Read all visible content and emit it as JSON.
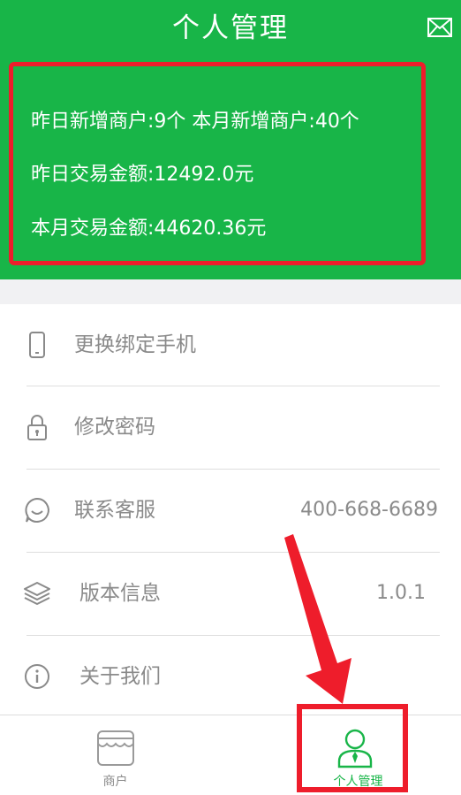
{
  "header": {
    "title": "个人管理"
  },
  "stats": {
    "line1": "昨日新增商户:9个   本月新增商户:40个",
    "line2": "昨日交易金额:12492.0元",
    "line3": "本月交易金额:44620.36元"
  },
  "menu": {
    "items": [
      {
        "label": "更换绑定手机",
        "value": "",
        "icon": "phone-icon"
      },
      {
        "label": "修改密码",
        "value": "",
        "icon": "lock-icon"
      },
      {
        "label": "联系客服",
        "value": "400-668-6689",
        "icon": "chat-icon"
      },
      {
        "label": "版本信息",
        "value": "1.0.1",
        "icon": "layers-icon"
      },
      {
        "label": "关于我们",
        "value": "",
        "icon": "info-icon"
      }
    ]
  },
  "tabbar": {
    "tabs": [
      {
        "label": "商户",
        "icon": "store-icon",
        "active": false
      },
      {
        "label": "个人管理",
        "icon": "person-icon",
        "active": true
      }
    ]
  },
  "colors": {
    "brand_green": "#18b548",
    "annotation_red": "#ee1d2b",
    "inactive_gray": "#8a8a8a"
  }
}
